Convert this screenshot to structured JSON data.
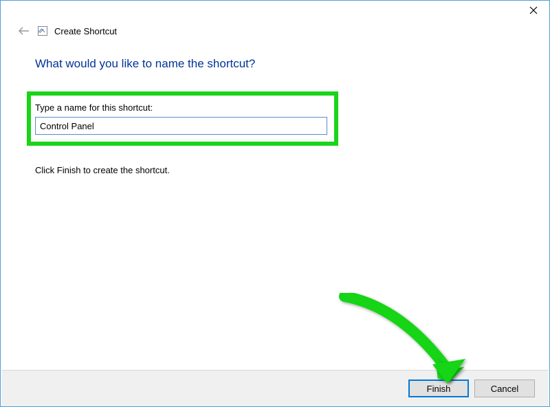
{
  "header": {
    "title": "Create Shortcut"
  },
  "page": {
    "heading": "What would you like to name the shortcut?",
    "field_label": "Type a name for this shortcut:",
    "input_value": "Control Panel",
    "instruction": "Click Finish to create the shortcut."
  },
  "footer": {
    "finish_label": "Finish",
    "cancel_label": "Cancel"
  },
  "annotations": {
    "highlight_color": "#19d419",
    "arrow_color": "#19d419"
  }
}
